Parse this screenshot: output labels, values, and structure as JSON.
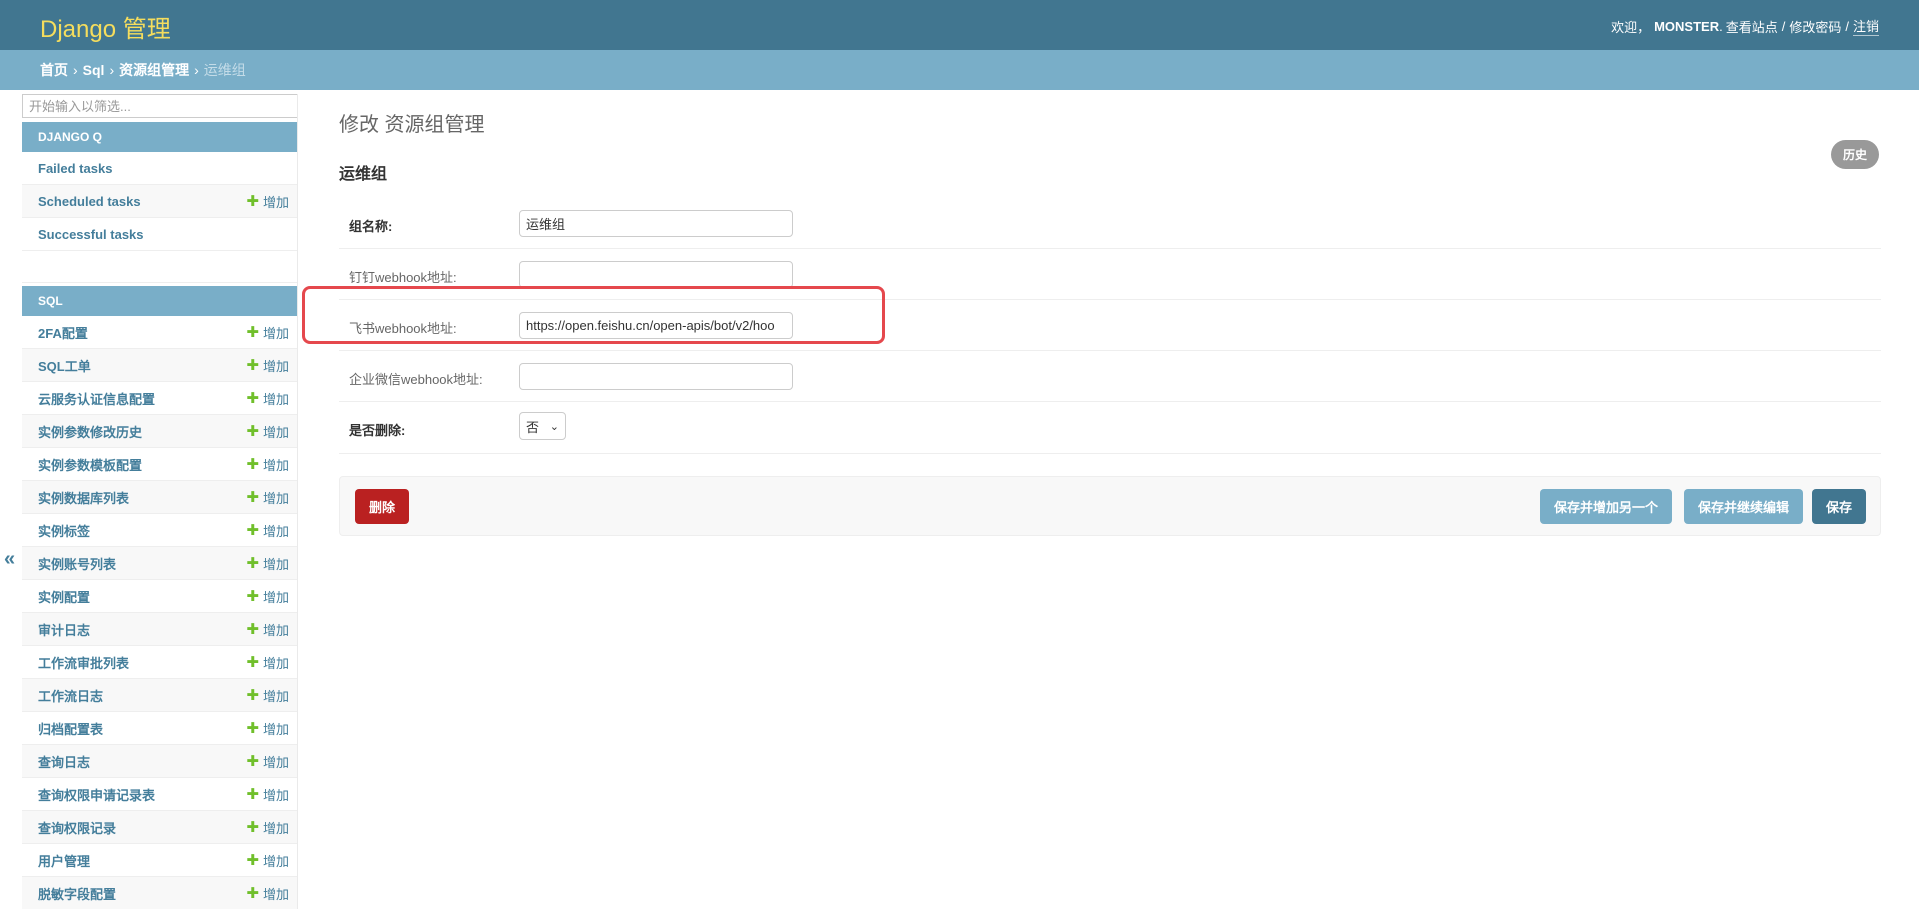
{
  "header": {
    "brand": "Django 管理",
    "welcome": "欢迎，",
    "username": "MONSTER",
    "username_suffix": ".",
    "view_site": "查看站点",
    "change_password": "修改密码",
    "logout": "注销",
    "separator": "/"
  },
  "breadcrumbs": {
    "home": "首页",
    "app": "Sql",
    "model": "资源组管理",
    "current": "运维组",
    "arrow": "›"
  },
  "sidebar": {
    "filter_placeholder": "开始输入以筛选...",
    "toggle": "«",
    "add_label": "增加",
    "django_q": {
      "caption": "DJANGO Q",
      "items": [
        {
          "label": "Failed tasks",
          "add": false
        },
        {
          "label": "Scheduled tasks",
          "add": true
        },
        {
          "label": "Successful tasks",
          "add": false
        }
      ]
    },
    "sql": {
      "caption": "SQL",
      "items": [
        {
          "label": "2FA配置"
        },
        {
          "label": "SQL工单"
        },
        {
          "label": "云服务认证信息配置"
        },
        {
          "label": "实例参数修改历史"
        },
        {
          "label": "实例参数模板配置"
        },
        {
          "label": "实例数据库列表"
        },
        {
          "label": "实例标签"
        },
        {
          "label": "实例账号列表"
        },
        {
          "label": "实例配置"
        },
        {
          "label": "审计日志"
        },
        {
          "label": "工作流审批列表"
        },
        {
          "label": "工作流日志"
        },
        {
          "label": "归档配置表"
        },
        {
          "label": "查询日志"
        },
        {
          "label": "查询权限申请记录表"
        },
        {
          "label": "查询权限记录"
        },
        {
          "label": "用户管理"
        },
        {
          "label": "脱敏字段配置"
        }
      ]
    }
  },
  "content": {
    "page_title": "修改 资源组管理",
    "object_title": "运维组",
    "history": "历史",
    "fields": {
      "group_name": {
        "label": "组名称:",
        "value": "运维组"
      },
      "ding_webhook": {
        "label": "钉钉webhook地址:",
        "value": ""
      },
      "feishu_webhook": {
        "label": "飞书webhook地址:",
        "value": "https://open.feishu.cn/open-apis/bot/v2/hoo"
      },
      "qywx_webhook": {
        "label": "企业微信webhook地址:",
        "value": ""
      },
      "is_deleted": {
        "label": "是否删除:",
        "value": "否"
      }
    }
  },
  "submit": {
    "delete": "删除",
    "save_add_another": "保存并增加另一个",
    "save_continue": "保存并继续编辑",
    "save": "保存"
  },
  "colors": {
    "header": "#417690",
    "breadcrumbs": "#79aec8",
    "brand": "#f5dd5d",
    "delete": "#ba2121",
    "add_plus": "#70bf2b",
    "highlight": "#e5484d"
  }
}
